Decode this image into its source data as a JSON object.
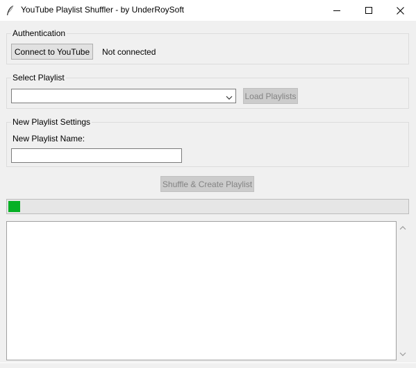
{
  "window": {
    "title": "YouTube Playlist Shuffler - by UnderRoySoft",
    "app_icon": "feather-icon",
    "controls": [
      "minimize-icon",
      "maximize-icon",
      "close-icon"
    ]
  },
  "authentication": {
    "legend": "Authentication",
    "connect_label": "Connect to YouTube",
    "status": "Not connected"
  },
  "playlist": {
    "legend": "Select Playlist",
    "selected": "",
    "load_label": "Load Playlists"
  },
  "settings": {
    "legend": "New Playlist Settings",
    "name_label": "New Playlist Name:",
    "name_value": ""
  },
  "shuffle_label": "Shuffle & Create Playlist",
  "progress": {
    "value_fraction": 0.03,
    "color": "#06b025"
  },
  "log": {
    "text": ""
  }
}
